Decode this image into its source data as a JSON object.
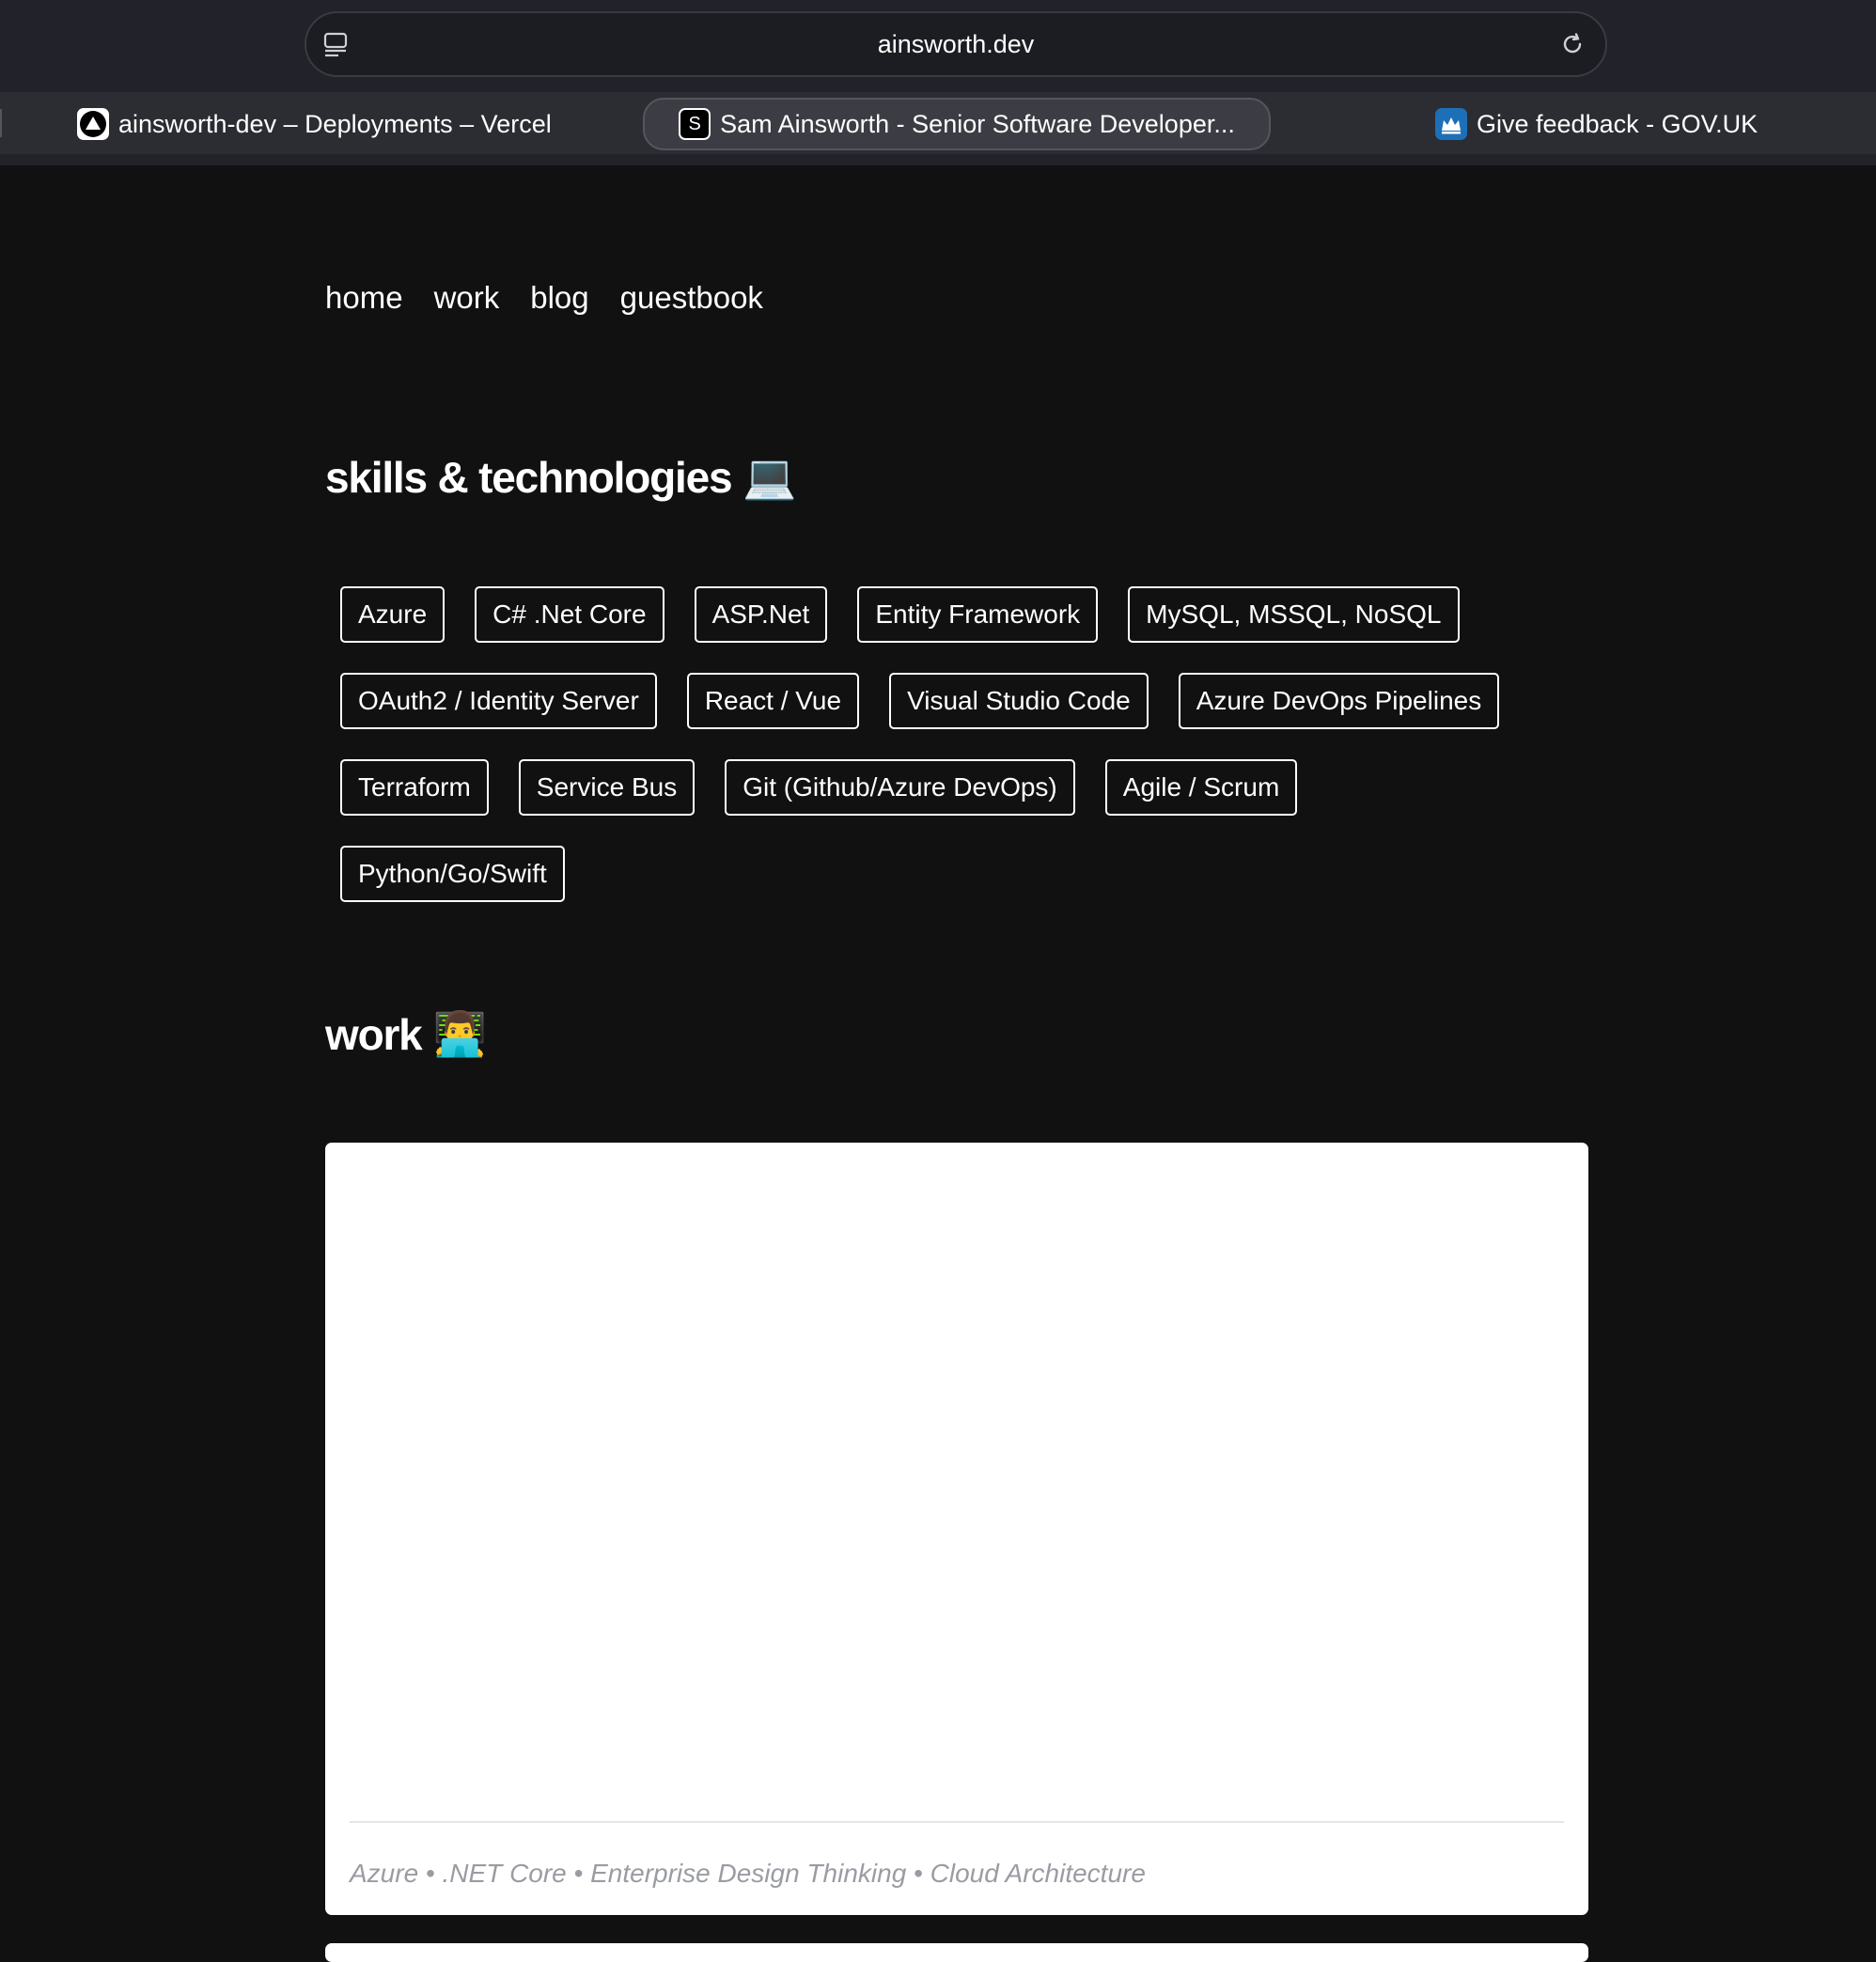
{
  "browser": {
    "url": "ainsworth.dev",
    "tabs": [
      {
        "title": "ainsworth-dev – Deployments – Vercel",
        "icon": "vercel-icon",
        "active": false
      },
      {
        "title": "Sam Ainsworth - Senior Software Developer...",
        "icon": "site-s-icon",
        "favicon_text": "S",
        "active": true
      },
      {
        "title": "Give feedback - GOV.UK",
        "icon": "govuk-crown-icon",
        "active": false
      }
    ]
  },
  "nav": {
    "items": [
      "home",
      "work",
      "blog",
      "guestbook"
    ]
  },
  "skills": {
    "title": "skills & technologies",
    "emoji": "💻",
    "rows": [
      [
        "Azure",
        "C# .Net Core",
        "ASP.Net",
        "Entity Framework",
        "MySQL, MSSQL, NoSQL"
      ],
      [
        "OAuth2 / Identity Server",
        "React / Vue",
        "Visual Studio Code",
        "Azure DevOps Pipelines"
      ],
      [
        "Terraform",
        "Service Bus",
        "Git (Github/Azure DevOps)",
        "Agile / Scrum"
      ],
      [
        "Python/Go/Swift"
      ]
    ]
  },
  "work": {
    "title": "work",
    "emoji": "👨‍💻",
    "card": {
      "tags": "Azure • .NET Core • Enterprise Design Thinking • Cloud Architecture"
    }
  },
  "colors": {
    "page_background": "#111111",
    "chrome_background": "#22232a",
    "card_background": "#ffffff",
    "card_tags_text": "#9a9ca3"
  }
}
